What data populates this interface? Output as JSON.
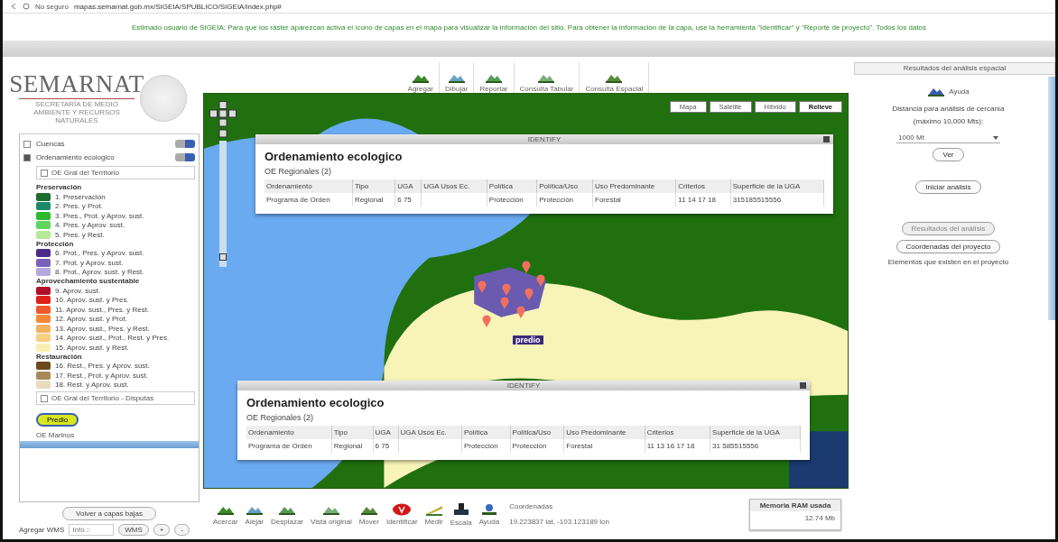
{
  "browser": {
    "security": "No seguro",
    "url": "mapas.semarnat.gob.mx/SIGEIA/SPUBLICO/SIGEIA/index.php#"
  },
  "notice": "Estimado usuario de SIGEIA: Para que los ráster aparezcan activa el ícono de capas en el mapa para visualizar la información del sitio. Para obtener la información de la capa, use la herramienta \"Identificar\" y \"Reporte de proyecto\". Todos los datos",
  "logo": {
    "name": "SEMARNAT",
    "subtitle": "SECRETARÍA DE MEDIO AMBIENTE Y RECURSOS NATURALES"
  },
  "layers": [
    {
      "label": "Cuencas",
      "checked": false
    },
    {
      "label": "Ordenamiento ecologico",
      "checked": true
    }
  ],
  "legend": {
    "title": "OE Gral del Territorio",
    "checked": false,
    "groups": [
      {
        "name": "Preservación",
        "items": [
          {
            "label": "1. Preservación",
            "color": "#1e6b2e"
          },
          {
            "label": "2. Pres. y Prot.",
            "color": "#1a8a6a"
          },
          {
            "label": "3. Pres., Prot. y Aprov. sust.",
            "color": "#2db82d"
          },
          {
            "label": "4. Pres. y Aprov. sust.",
            "color": "#5ed65e"
          },
          {
            "label": "5. Pres. y Rest.",
            "color": "#b6e89a"
          }
        ]
      },
      {
        "name": "Protección",
        "items": [
          {
            "label": "6. Prot., Pres. y Aprov. sust.",
            "color": "#4a2d8a"
          },
          {
            "label": "7. Prot. y Aprov. sust.",
            "color": "#7a62b8"
          },
          {
            "label": "8. Prot., Aprov. sust. y Rest.",
            "color": "#b6a8dd"
          }
        ]
      },
      {
        "name": "Aprovechamiento sustentable",
        "items": [
          {
            "label": "9. Aprov. sust.",
            "color": "#b0102a"
          },
          {
            "label": "10. Aprov. sust. y Pres.",
            "color": "#e0201a"
          },
          {
            "label": "11. Aprov. sust., Pres. y Rest.",
            "color": "#ee5a2a"
          },
          {
            "label": "12. Aprov. sust. y Prot.",
            "color": "#f08a3a"
          },
          {
            "label": "13. Aprov. sust., Pres. y Rest.",
            "color": "#f3b060"
          },
          {
            "label": "14. Aprov. sust., Prot., Rest. y Pres.",
            "color": "#f6cf80"
          },
          {
            "label": "15. Aprov. sust. y Rest.",
            "color": "#f8f0b0"
          }
        ]
      },
      {
        "name": "Restauración",
        "items": [
          {
            "label": "16. Rest., Pres. y Aprov. sust.",
            "color": "#6a4a1a"
          },
          {
            "label": "17. Rest., Prot. y Aprov. sust.",
            "color": "#a88a5a"
          },
          {
            "label": "18. Rest. y Aprov. sust.",
            "color": "#e8dcc0"
          }
        ]
      }
    ]
  },
  "extra_layers": [
    {
      "label": "OE Gral del Territorio - Disputas",
      "checked": false
    }
  ],
  "tag": "Predio",
  "cut_layer": "OE Marinos",
  "base_button": "Volver a capas bajas",
  "wms": {
    "label": "Agregar WMS",
    "placeholder": "Info ::",
    "select": "WMS",
    "add": "+",
    "remove": "-"
  },
  "top_tools": [
    "Agregar",
    "Dibujar",
    "Reportar",
    "Consulta Tabular",
    "Consulta Espacial"
  ],
  "zoom_slider": {
    "level": 0.05
  },
  "map_types": [
    {
      "label": "Mapa",
      "selected": false
    },
    {
      "label": "Satélite",
      "selected": false
    },
    {
      "label": "Híbrido",
      "selected": false
    },
    {
      "label": "Relieve",
      "selected": true
    }
  ],
  "map_label": "predio",
  "popups": [
    {
      "header": "IDENTIFY",
      "title": "Ordenamiento ecologico",
      "subtitle": "OE Regionales (2)",
      "columns": [
        {
          "label": "Ordenamiento",
          "value": "Programa de Orden"
        },
        {
          "label": "Tipo",
          "value": "Regional"
        },
        {
          "label": "UGA",
          "value": "6 75"
        },
        {
          "label": "UGA Usos Ec."
        },
        {
          "label": "Política",
          "value": "Protección"
        },
        {
          "label": "Política/Uso",
          "value": "Protección"
        },
        {
          "label": "Uso Predominante",
          "value": "Forestal"
        },
        {
          "label": "Criterios",
          "value": "11 14 17 18"
        },
        {
          "label": "Superficie de la UGA",
          "value": "315185515556"
        }
      ]
    },
    {
      "header": "IDENTIFY",
      "title": "Ordenamiento ecologico",
      "subtitle": "OE Regionales (2)",
      "columns": [
        {
          "label": "Ordenamiento",
          "value": "Programa de Orden"
        },
        {
          "label": "Tipo",
          "value": "Regional"
        },
        {
          "label": "UGA",
          "value": "6 75"
        },
        {
          "label": "UGA Usos Ec."
        },
        {
          "label": "Política",
          "value": "Protección"
        },
        {
          "label": "Política/Uso",
          "value": "Protección"
        },
        {
          "label": "Uso Predominante",
          "value": "Forestal"
        },
        {
          "label": "Criterios",
          "value": "11 13 16 17 18"
        },
        {
          "label": "Superficie de la UGA",
          "value": "31 585515556"
        }
      ]
    }
  ],
  "bottom_tools": [
    "Acercar",
    "Alejar",
    "Desplazar",
    "Vista original",
    "Mover",
    "Identificar",
    "Medir",
    "Escala",
    "Ayuda"
  ],
  "coordinates": {
    "label": "Coordenadas",
    "value": "19.223837 lat, -103.123189 lon"
  },
  "memory": {
    "label": "Memoria RAM usada",
    "value": "12.74 Mb"
  },
  "analysis": {
    "header": "Resultados del análisis espacial",
    "help": "Ayuda",
    "distance_label": "Distancia para análisis de cercanía (máximo 10,000 Mts):",
    "distance_value": "1000 Mt",
    "view_button": "Ver",
    "start_button": "Iniciar análisis",
    "results_button": "Resultados del análisis",
    "coords_button": "Coordenadas del proyecto",
    "elements_text": "Elementos que existen en el proyecto"
  }
}
